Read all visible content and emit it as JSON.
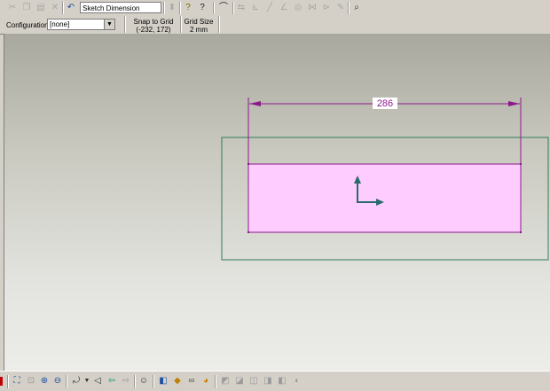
{
  "toolbar": {
    "command_value": "Sketch Dimension",
    "icons": [
      "cut-icon",
      "copy-icon",
      "paste-icon",
      "delete-icon",
      "undo-icon"
    ]
  },
  "config": {
    "label": "Configuration:",
    "selected": "[none]"
  },
  "snap": {
    "label": "Snap to Grid",
    "coords": "(-232, 172)"
  },
  "grid": {
    "label": "Grid Size",
    "value": "2 mm"
  },
  "sketch": {
    "dimension_value": "286",
    "colors": {
      "profile_fill": "#ffccff",
      "profile_stroke": "#8b1a8b",
      "bounding_box": "#2f7d5a",
      "dimension_line": "#8b1a8b",
      "axis": "#2a6a6a"
    }
  }
}
